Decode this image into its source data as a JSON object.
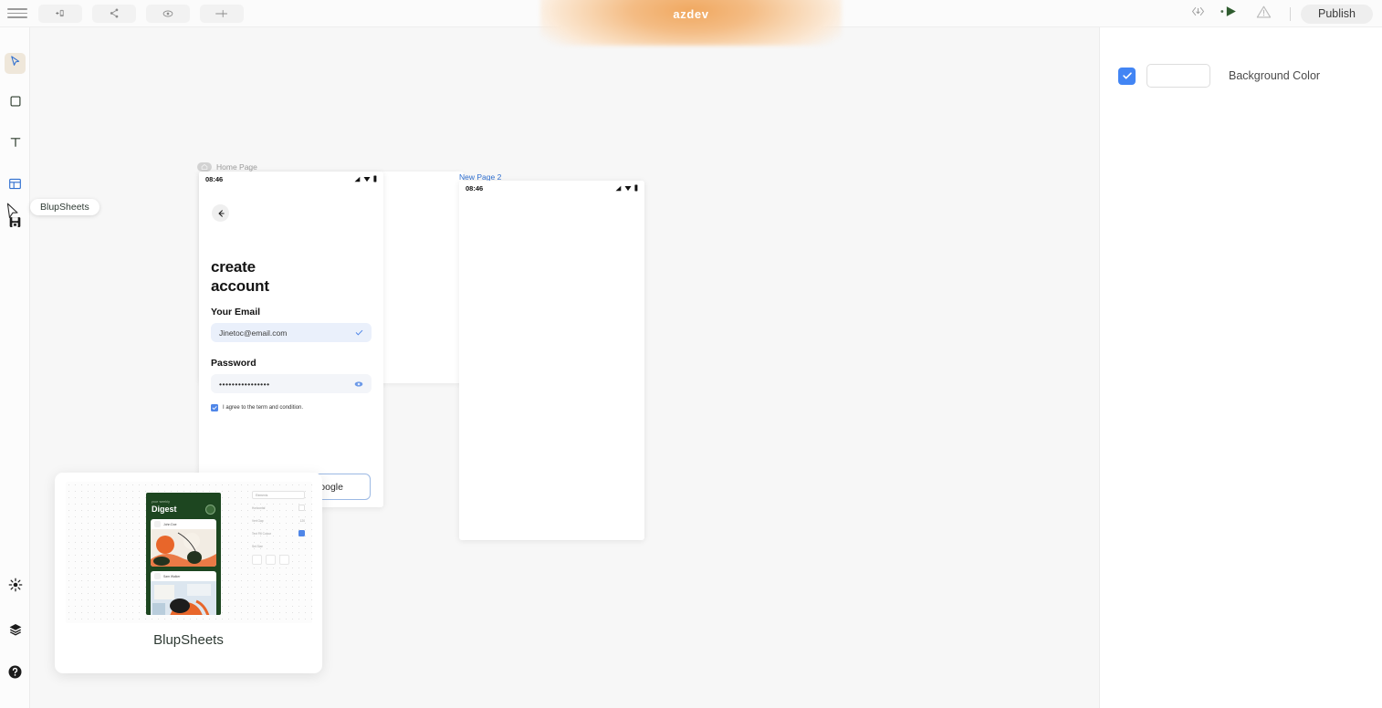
{
  "topbar": {
    "menu_icon": "hamburger-icon",
    "tools": [
      {
        "icon": "add-component-icon",
        "name": "add-component"
      },
      {
        "icon": "sitemap-icon",
        "name": "sitemap"
      },
      {
        "icon": "eye-icon",
        "name": "preview"
      },
      {
        "icon": "plus-icon",
        "name": "add"
      }
    ],
    "brand": "azdev",
    "right_icons": [
      {
        "icon": "code-download-icon",
        "name": "code-export"
      },
      {
        "icon": "play-icon",
        "name": "run-preview"
      },
      {
        "icon": "warning-icon",
        "name": "warnings"
      }
    ],
    "publish_label": "Publish"
  },
  "rail": {
    "items": [
      {
        "icon": "cursor-icon",
        "name": "select-tool",
        "active": true
      },
      {
        "icon": "rectangle-icon",
        "name": "rectangle-tool",
        "active": false
      },
      {
        "icon": "text-icon",
        "name": "text-tool",
        "active": false
      },
      {
        "icon": "layout-icon",
        "name": "layout-tool",
        "active": false
      },
      {
        "icon": "save-sheets-icon",
        "name": "blupsheets-tool",
        "active": false
      }
    ],
    "bottom_items": [
      {
        "icon": "sparkle-icon",
        "name": "ai-assist"
      },
      {
        "icon": "layers-icon",
        "name": "layers"
      },
      {
        "icon": "help-icon",
        "name": "help"
      }
    ],
    "tooltip": "BlupSheets"
  },
  "canvas": {
    "frame1": {
      "label": "Home Page",
      "status_time": "08:46",
      "heading_line1": "create",
      "heading_line2": "account",
      "email_label": "Your Email",
      "email_value": "Jinetoc@email.com",
      "password_label": "Password",
      "password_value": "••••••••••••••••",
      "agree_text": "I agree to the term and condition.",
      "google_button": "Sign up with Google"
    },
    "frame2": {
      "label": "New Page 2",
      "status_time": "08:46"
    },
    "preview_card": {
      "title": "BlupSheets",
      "mock": {
        "eyebrow": "your weekly",
        "heading": "Digest",
        "card1_name": "John Doe",
        "card2_name": "Sam Walker"
      },
      "panel": {
        "pill": "Elements",
        "rows": [
          {
            "label": "Horizontal",
            "value": ""
          },
          {
            "label": "Vert Gap",
            "value": "120"
          },
          {
            "label": "Text Fill Colour",
            "value": ""
          }
        ],
        "group_label": "Set Size"
      }
    }
  },
  "rightpanel": {
    "background_color_label": "Background Color",
    "background_color_value": "#ffffff",
    "checkbox_checked": true
  },
  "colors": {
    "accent_blue": "#4285f4",
    "brand_orange": "#f0a860",
    "canvas_bg": "#f7f7f7",
    "mock_green": "#1d4620"
  }
}
